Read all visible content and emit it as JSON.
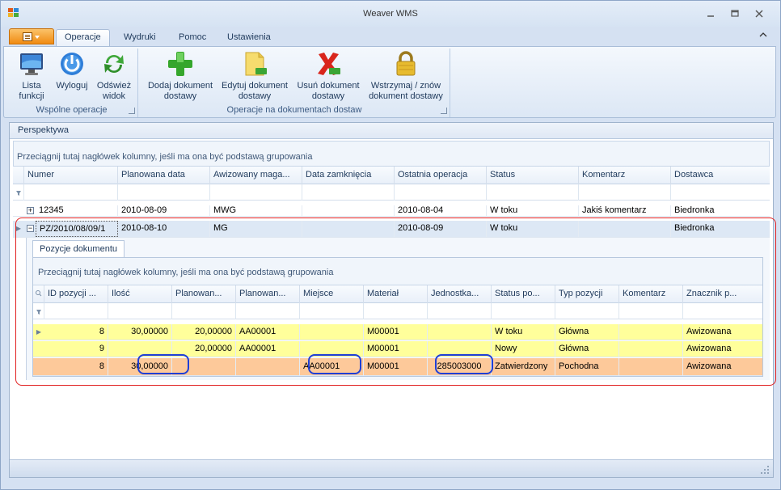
{
  "window": {
    "title": "Weaver WMS",
    "minimize_icon": "minimize-icon",
    "restore_icon": "restore-icon",
    "close_icon": "close-icon"
  },
  "ribbon": {
    "tabs": [
      "Operacje",
      "Wydruki",
      "Pomoc",
      "Ustawienia"
    ],
    "active_tab": "Operacje",
    "groups": [
      {
        "label": "Wspólne operacje",
        "buttons": [
          {
            "label": "Lista\nfunkcji",
            "icon": "monitor-icon"
          },
          {
            "label": "Wyloguj",
            "icon": "power-icon"
          },
          {
            "label": "Odśwież\nwidok",
            "icon": "refresh-icon"
          }
        ]
      },
      {
        "label": "Operacje na dokumentach dostaw",
        "buttons": [
          {
            "label": "Dodaj dokument\ndostawy",
            "icon": "add-document-icon"
          },
          {
            "label": "Edytuj dokument\ndostawy",
            "icon": "edit-document-icon"
          },
          {
            "label": "Usuń dokument\ndostawy",
            "icon": "delete-document-icon"
          },
          {
            "label": "Wstrzymaj / znów\ndokument dostawy",
            "icon": "lock-icon"
          }
        ]
      }
    ]
  },
  "panel": {
    "title": "Perspektywa"
  },
  "grid": {
    "group_hint": "Przeciągnij tutaj nagłówek kolumny, jeśli ma ona być podstawą grupowania",
    "columns": [
      "Numer",
      "Planowana data",
      "Awizowany maga...",
      "Data zamknięcia",
      "Ostatnia operacja",
      "Status",
      "Komentarz",
      "Dostawca"
    ],
    "rows": [
      [
        "12345",
        "2010-08-09",
        "MWG",
        "",
        "2010-08-04",
        "W toku",
        "Jakiś komentarz",
        "Biedronka"
      ],
      [
        "PZ/2010/08/09/1",
        "2010-08-10",
        "MG",
        "",
        "2010-08-09",
        "W toku",
        "",
        "Biedronka"
      ]
    ]
  },
  "detail": {
    "tab": "Pozycje dokumentu",
    "group_hint": "Przeciągnij tutaj nagłówek kolumny, jeśli ma ona być podstawą grupowania",
    "columns": [
      "ID pozycji ...",
      "Ilość",
      "Planowan...",
      "Planowan...",
      "Miejsce",
      "Materiał",
      "Jednostka...",
      "Status po...",
      "Typ pozycji",
      "Komentarz",
      "Znacznik p..."
    ],
    "rows": [
      [
        "8",
        "30,00000",
        "20,00000",
        "AA00001",
        "",
        "M00001",
        "",
        "W toku",
        "Główna",
        "",
        "Awizowana"
      ],
      [
        "9",
        "",
        "20,00000",
        "AA00001",
        "",
        "M00001",
        "",
        "Nowy",
        "Główna",
        "",
        "Awizowana"
      ],
      [
        "8",
        "30,00000",
        "",
        "",
        "AA00001",
        "M00001",
        "285003000",
        "Zatwierdzony",
        "Pochodna",
        "",
        "Awizowana"
      ]
    ],
    "row_colors": [
      "#ffff9b",
      "#ffff9b",
      "#fdc99a"
    ]
  }
}
